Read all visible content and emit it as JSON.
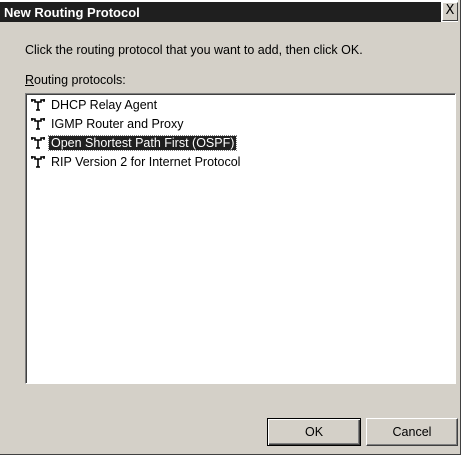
{
  "dialog": {
    "title": "New Routing Protocol",
    "close_glyph": "X",
    "instruction": "Click the routing protocol that you want to add, then click OK.",
    "list_label_mnemonic": "R",
    "list_label_rest": "outing protocols:",
    "protocols": [
      {
        "label": "DHCP Relay Agent",
        "icon": "routing-protocol-icon",
        "selected": false
      },
      {
        "label": "IGMP Router and Proxy",
        "icon": "routing-protocol-icon",
        "selected": false
      },
      {
        "label": "Open Shortest Path First (OSPF)",
        "icon": "routing-protocol-icon",
        "selected": true
      },
      {
        "label": "RIP Version 2 for Internet Protocol",
        "icon": "routing-protocol-icon",
        "selected": false
      }
    ],
    "ok_label": "OK",
    "cancel_label": "Cancel"
  },
  "colors": {
    "dialog_background": "#d4d0c8",
    "titlebar_background": "#1f1f1f",
    "selection_background": "#1f1f1f",
    "list_background": "#ffffff"
  }
}
